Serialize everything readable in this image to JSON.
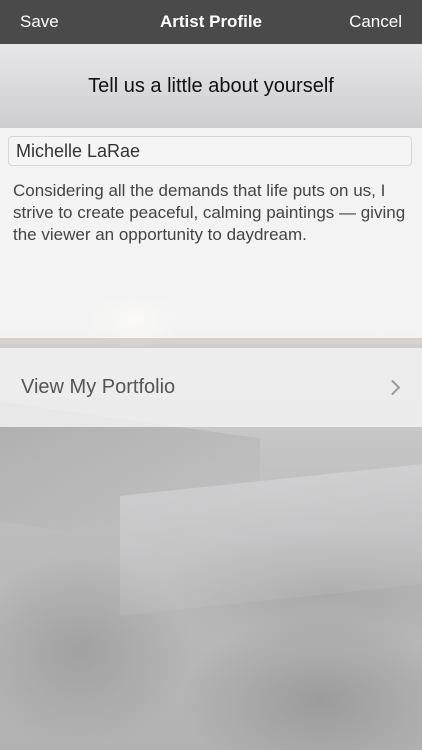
{
  "navbar": {
    "left_button": "Save",
    "title": "Artist Profile",
    "right_button": "Cancel"
  },
  "header": {
    "heading": "Tell us a little about yourself"
  },
  "profile": {
    "name_value": "Michelle LaRae",
    "bio": "Considering all the demands that life puts on us, I strive to create peaceful, calming paintings — giving the viewer an opportunity to daydream."
  },
  "portfolio": {
    "label": "View My Portfolio",
    "icon": "chevron-right-icon"
  }
}
